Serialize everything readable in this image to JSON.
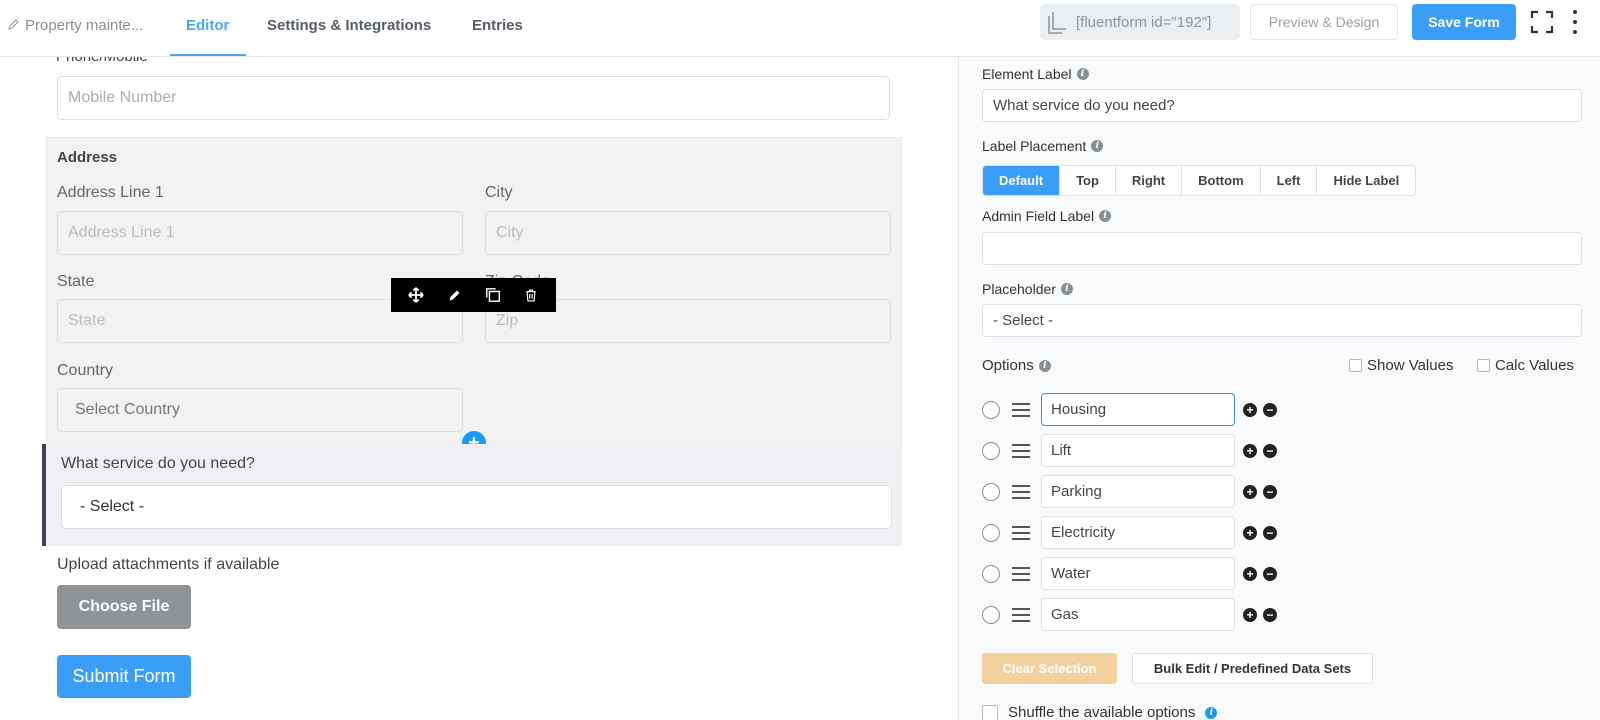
{
  "header": {
    "form_name": "Property mainte...",
    "tabs": [
      "Editor",
      "Settings & Integrations",
      "Entries"
    ],
    "shortcode": "[fluentform id=\"192\"]",
    "preview_label": "Preview & Design",
    "save_label": "Save Form",
    "accent_color": "#3a9ef7"
  },
  "editor": {
    "phone_label": "Phone/Mobile",
    "mobile_placeholder": "Mobile Number",
    "address": {
      "title": "Address",
      "line1_label": "Address Line 1",
      "line1_placeholder": "Address Line 1",
      "city_label": "City",
      "city_placeholder": "City",
      "state_label": "State",
      "state_placeholder": "State",
      "zip_label": "Zip Code",
      "zip_placeholder": "Zip",
      "country_label": "Country",
      "country_placeholder": "Select Country"
    },
    "toolbar_icons": [
      "move-icon",
      "pencil-icon",
      "copy-icon",
      "trash-icon"
    ],
    "service_label": "What service do you need?",
    "service_select": "- Select -",
    "upload_label": "Upload attachments if available",
    "choose_file_label": "Choose File",
    "submit_label": "Submit Form"
  },
  "panel": {
    "element_label_title": "Element Label",
    "element_label_value": "What service do you need?",
    "label_placement_title": "Label Placement",
    "placement_options": [
      "Default",
      "Top",
      "Right",
      "Bottom",
      "Left",
      "Hide Label"
    ],
    "placement_selected": "Default",
    "admin_field_label_title": "Admin Field Label",
    "admin_field_label_value": "",
    "placeholder_title": "Placeholder",
    "placeholder_value": "- Select -",
    "options_title": "Options",
    "show_values_label": "Show Values",
    "calc_values_label": "Calc Values",
    "options": [
      "Housing",
      "Lift",
      "Parking",
      "Electricity",
      "Water",
      "Gas"
    ],
    "clear_selection_label": "Clear Selection",
    "bulk_edit_label": "Bulk Edit / Predefined Data Sets",
    "shuffle_label": "Shuffle the available options"
  }
}
